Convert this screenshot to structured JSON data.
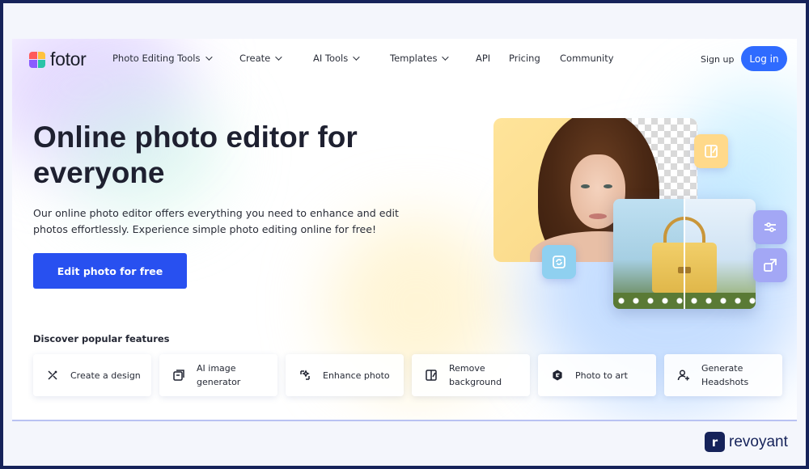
{
  "nav": {
    "logo_text": "fotor",
    "items": [
      {
        "label": "Photo Editing Tools",
        "dropdown": true
      },
      {
        "label": "Create",
        "dropdown": true
      },
      {
        "label": "AI Tools",
        "dropdown": true
      },
      {
        "label": "Templates",
        "dropdown": true
      },
      {
        "label": "API",
        "dropdown": false
      },
      {
        "label": "Pricing",
        "dropdown": false
      },
      {
        "label": "Community",
        "dropdown": false
      }
    ],
    "signup_label": "Sign up",
    "login_label": "Log in"
  },
  "hero": {
    "title": "Online photo editor for everyone",
    "subtitle": "Our online photo editor offers everything you need to enhance and edit photos effortlessly. Experience simple photo editing online for free!",
    "cta_label": "Edit photo for free"
  },
  "features": {
    "title": "Discover popular features",
    "items": [
      {
        "label": "Create a design",
        "icon": "design-icon"
      },
      {
        "label": "AI image generator",
        "icon": "ai-image-icon"
      },
      {
        "label": "Enhance photo",
        "icon": "enhance-icon"
      },
      {
        "label": "Remove background",
        "icon": "remove-bg-icon"
      },
      {
        "label": "Photo to art",
        "icon": "photo-to-art-icon"
      },
      {
        "label": "Generate Headshots",
        "icon": "headshot-icon"
      }
    ]
  },
  "brand": {
    "mark": "r",
    "name": "revoyant"
  },
  "colors": {
    "accent": "#2f6bff",
    "cta": "#2850f0",
    "frame": "#16235a"
  }
}
